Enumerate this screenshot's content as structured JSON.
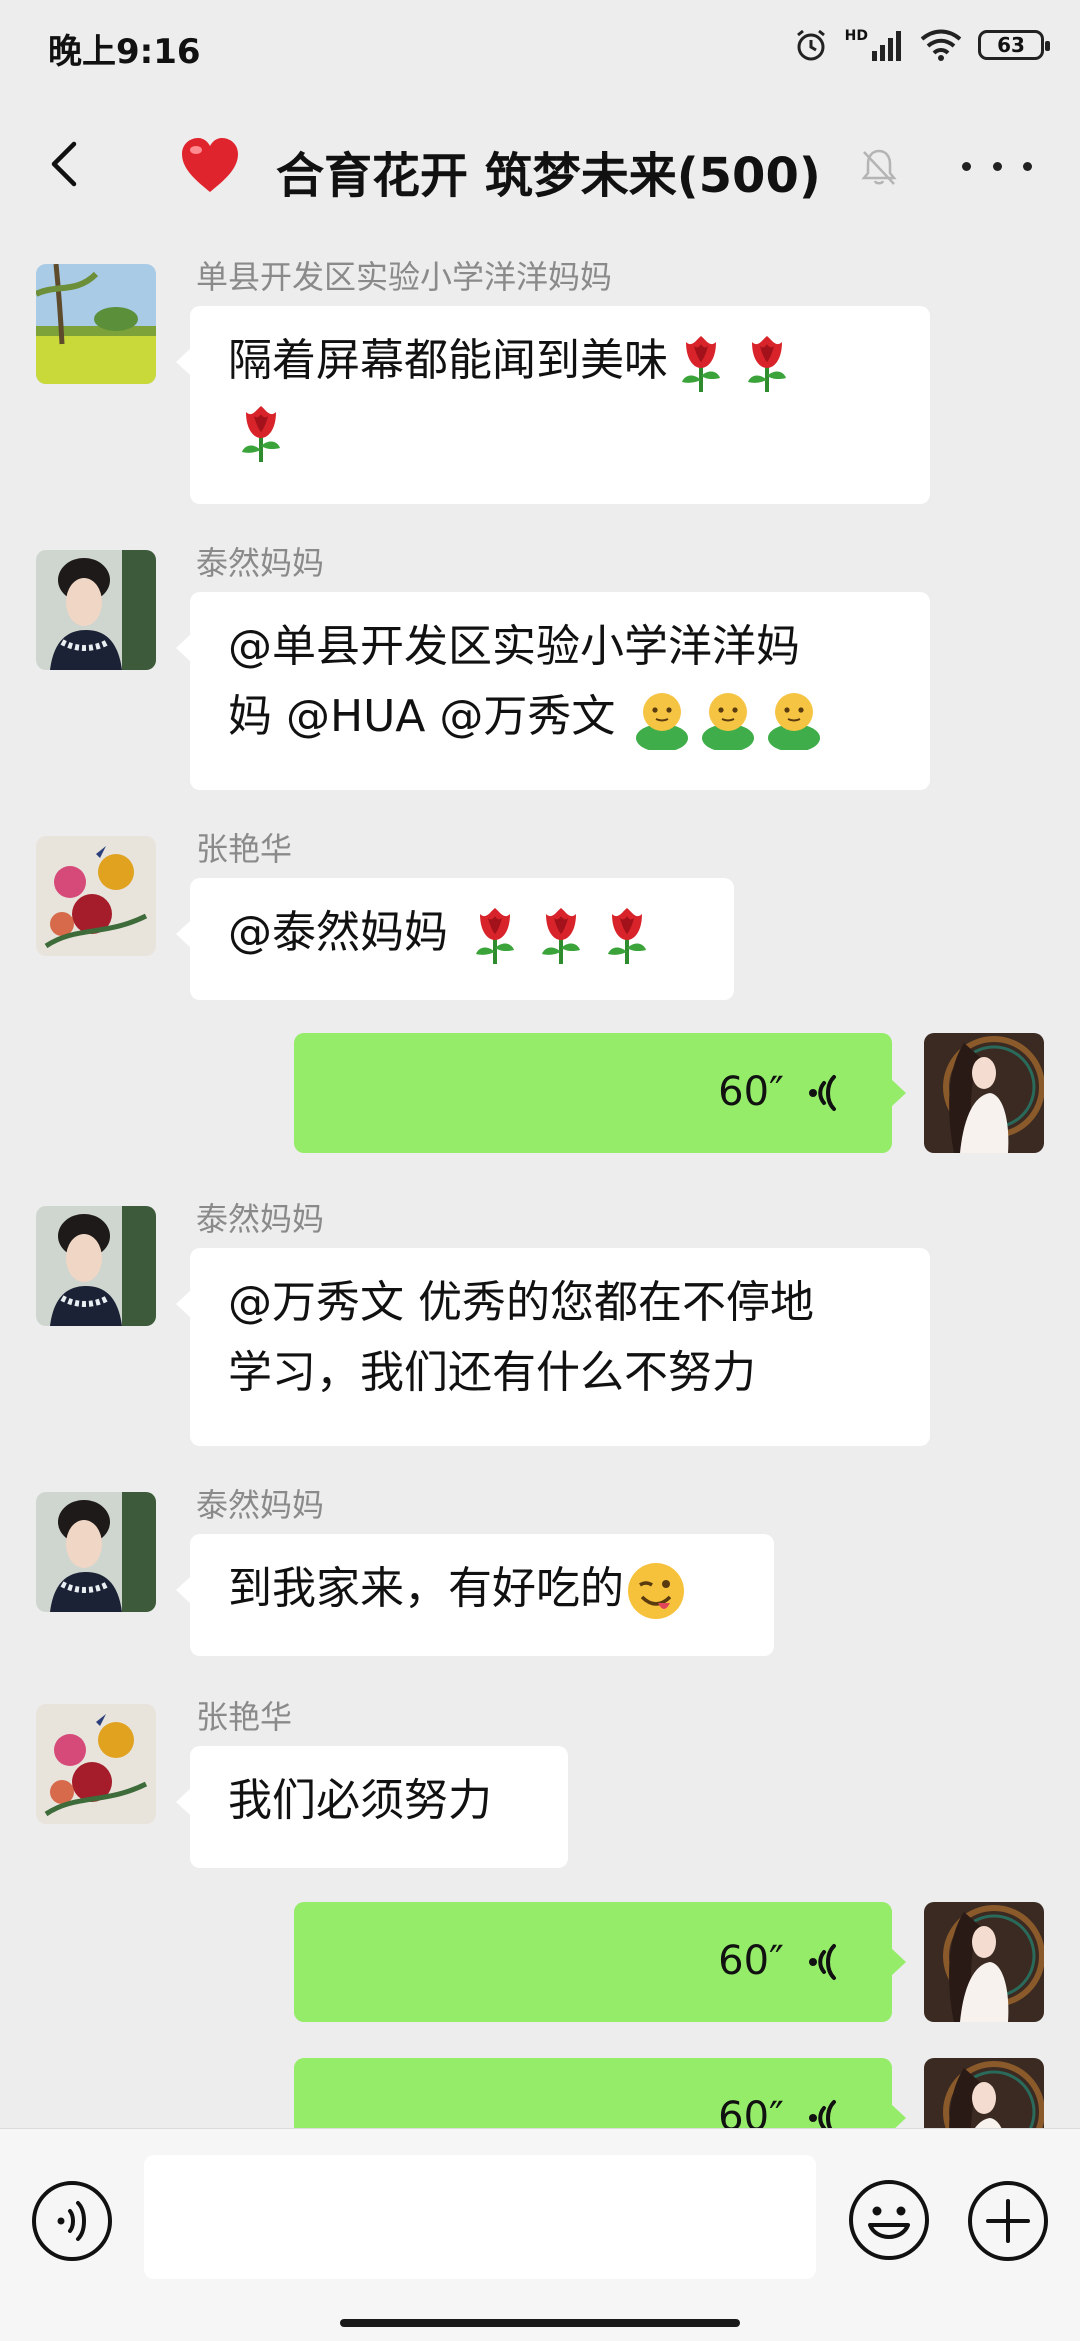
{
  "status": {
    "time": "晚上9:16",
    "network": "HD",
    "battery": "63"
  },
  "header": {
    "title": "合育花开 筑梦未来(500)"
  },
  "messages": [
    {
      "sender": "单县开发区实验小学洋洋妈妈",
      "line1": "隔着屏幕都能闻到美味",
      "line2": ""
    },
    {
      "sender": "泰然妈妈",
      "line1": "@单县开发区实验小学洋洋妈",
      "line2": "妈  @HUA @万秀文  "
    },
    {
      "sender": "张艳华",
      "line1": "@泰然妈妈  "
    },
    {
      "duration": "60″"
    },
    {
      "sender": "泰然妈妈",
      "line1": "@万秀文  优秀的您都在不停地",
      "line2": "学习，我们还有什么不努力"
    },
    {
      "sender": "泰然妈妈",
      "line1": "到我家来，有好吃的"
    },
    {
      "sender": "张艳华",
      "line1": "我们必须努力"
    },
    {
      "duration": "60″"
    },
    {
      "duration": "60″"
    }
  ],
  "input": {
    "value": ""
  },
  "colors": {
    "background": "#ededed",
    "own_bubble": "#95ec69",
    "peer_bubble": "#ffffff",
    "sender_name": "#8a8a8a"
  }
}
